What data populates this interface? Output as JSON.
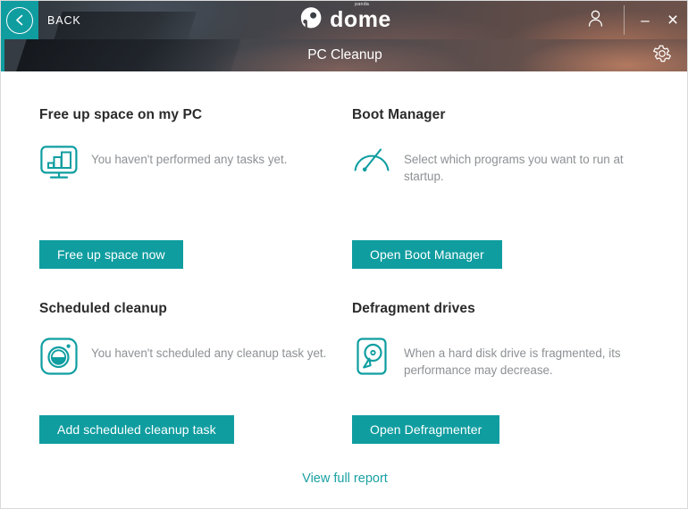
{
  "window": {
    "back_label": "BACK",
    "logo_text": "dome",
    "logo_superscript": "panda",
    "subheader_title": "PC Cleanup",
    "minimize_glyph": "–",
    "close_glyph": "×"
  },
  "icons": {
    "back": "chevron-left-icon",
    "user": "user-icon",
    "gear": "gear-icon"
  },
  "cards": [
    {
      "title": "Free up space on my PC",
      "description": "You haven't performed any tasks yet.",
      "icon": "monitor-chart-icon",
      "button": "Free up space now"
    },
    {
      "title": "Boot Manager",
      "description": "Select which programs you want to run at startup.",
      "icon": "gauge-icon",
      "button": "Open Boot Manager"
    },
    {
      "title": "Scheduled cleanup",
      "description": "You haven't scheduled any cleanup task yet.",
      "icon": "timer-icon",
      "button": "Add scheduled cleanup task"
    },
    {
      "title": "Defragment drives",
      "description": "When a hard disk drive is fragmented, its performance may decrease.",
      "icon": "hard-disk-icon",
      "button": "Open Defragmenter"
    }
  ],
  "footer": {
    "report_link": "View full report"
  },
  "colors": {
    "accent_teal": "#109da0",
    "link_teal": "#1aa0a3",
    "title_text": "#2b2b2b",
    "desc_text": "#8d9194"
  }
}
